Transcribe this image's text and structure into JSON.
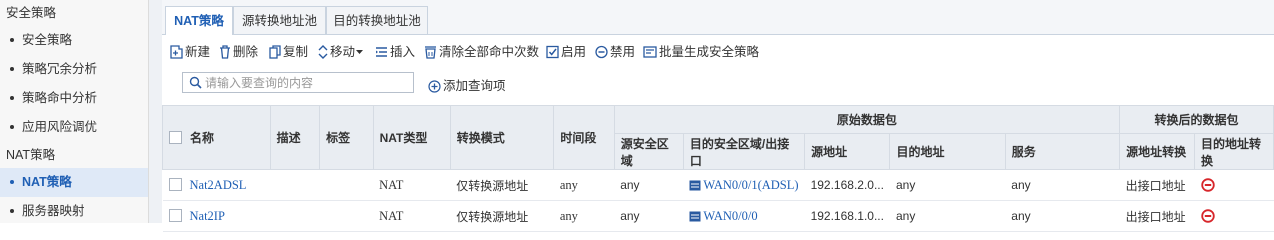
{
  "sidebar": {
    "groups": [
      {
        "label": "安全策略",
        "items": [
          "安全策略",
          "策略冗余分析",
          "策略命中分析",
          "应用风险调优"
        ]
      },
      {
        "label": "NAT策略",
        "items": [
          "NAT策略",
          "服务器映射"
        ]
      }
    ],
    "active_item": "NAT策略"
  },
  "tabs": [
    "NAT策略",
    "源转换地址池",
    "目的转换地址池"
  ],
  "toolbar": {
    "new": "新建",
    "delete": "删除",
    "copy": "复制",
    "move": "移动",
    "insert": "插入",
    "clear_hits": "清除全部命中次数",
    "enable": "启用",
    "disable": "禁用",
    "bulk_generate": "批量生成安全策略"
  },
  "search": {
    "placeholder": "请输入要查询的内容",
    "add_query": "添加查询项"
  },
  "table": {
    "headers": {
      "name": "名称",
      "description": "描述",
      "tag": "标签",
      "nat_type": "NAT类型",
      "mode": "转换模式",
      "time": "时间段",
      "original_group": "原始数据包",
      "translated_group": "转换后的数据包",
      "src_zone": "源安全区域",
      "dst_zone": "目的安全区域/出接口",
      "src_addr": "源地址",
      "dst_addr": "目的地址",
      "service": "服务",
      "src_trans": "源地址转换",
      "dst_trans": "目的地址转换"
    },
    "rows": [
      {
        "name": "Nat2ADSL",
        "nat_type": "NAT",
        "mode": "仅转换源地址",
        "time": "any",
        "src_zone": "any",
        "dst_zone": "WAN0/0/1(ADSL)",
        "src_addr": "192.168.2.0...",
        "dst_addr": "any",
        "service": "any",
        "src_trans": "出接口地址"
      },
      {
        "name": "Nat2IP",
        "nat_type": "NAT",
        "mode": "仅转换源地址",
        "time": "any",
        "src_zone": "any",
        "dst_zone": "WAN0/0/0",
        "src_addr": "192.168.1.0...",
        "dst_addr": "any",
        "service": "any",
        "src_trans": "出接口地址"
      }
    ]
  }
}
